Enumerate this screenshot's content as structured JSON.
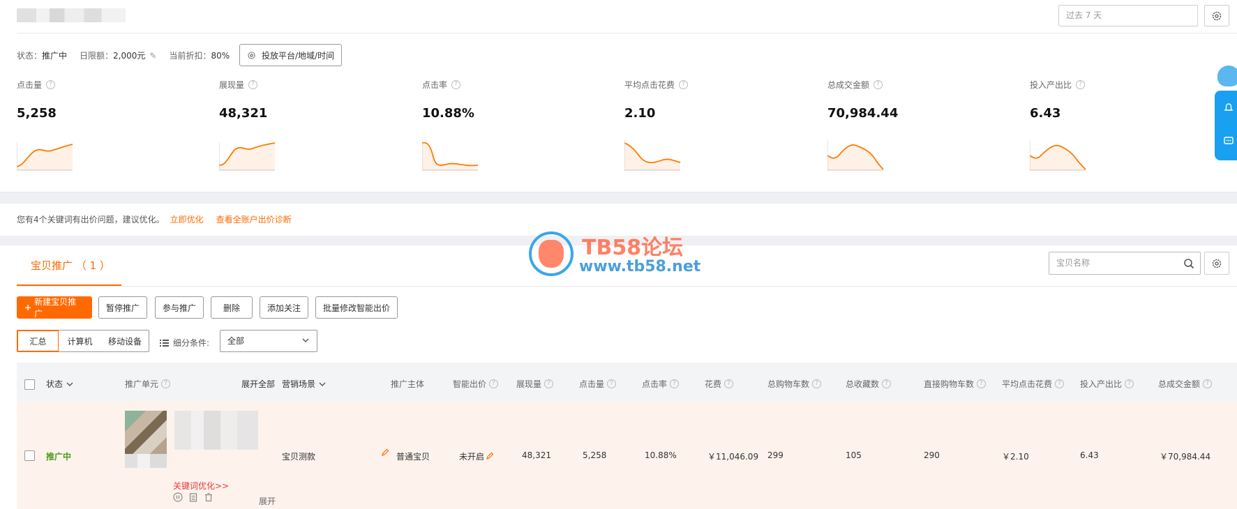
{
  "header": {
    "date_range_placeholder": "过去 7 天"
  },
  "status": {
    "state_label": "状态：",
    "state_value": "推广中",
    "budget_label": "日限额：",
    "budget_value": "2,000元",
    "discount_label": "当前折扣：",
    "discount_value": "80%",
    "platform_button": "投放平台/地域/时间"
  },
  "metrics": [
    {
      "label": "点击量",
      "value": "5,258"
    },
    {
      "label": "展现量",
      "value": "48,321"
    },
    {
      "label": "点击率",
      "value": "10.88%"
    },
    {
      "label": "平均点击花费",
      "value": "2.10"
    },
    {
      "label": "总成交金额",
      "value": "70,984.44"
    },
    {
      "label": "投入产出比",
      "value": "6.43"
    }
  ],
  "tip": {
    "text": "您有4个关键词有出价问题，建议优化。",
    "link1": "立即优化",
    "link2": "查看全账户出价诊断"
  },
  "main": {
    "tab_label": "宝贝推广 （ 1 ）",
    "search_placeholder": "宝贝名称",
    "buttons": {
      "new": "新建宝贝推广",
      "pause": "暂停推广",
      "join": "参与推广",
      "delete": "删除",
      "follow": "添加关注",
      "batch": "批量修改智能出价"
    },
    "segments": [
      "汇总",
      "计算机",
      "移动设备"
    ],
    "filter_label": "细分条件:",
    "filter_value": "全部"
  },
  "table": {
    "headers": {
      "status": "状态",
      "unit": "推广单元",
      "expand_all": "展开全部",
      "scene": "营销场景",
      "subject": "推广主体",
      "smart_bid": "智能出价",
      "impressions": "展现量",
      "clicks": "点击量",
      "ctr": "点击率",
      "cost": "花费",
      "cart_total": "总购物车数",
      "fav_total": "总收藏数",
      "cart_direct": "直接购物车数",
      "avg_cpc": "平均点击花费",
      "roi": "投入产出比",
      "gmv": "总成交金额"
    },
    "row": {
      "status": "推广中",
      "scene": "宝贝测款",
      "subject": "普通宝贝",
      "smart_bid": "未开启",
      "impressions": "48,321",
      "clicks": "5,258",
      "ctr": "10.88%",
      "cost": "￥11,046.09",
      "cart_total": "299",
      "fav_total": "105",
      "cart_direct": "290",
      "avg_cpc": "￥2.10",
      "roi": "6.43",
      "gmv": "￥70,984.44",
      "keyword_link": "关键词优化>>",
      "expand": "展开"
    }
  },
  "watermark": {
    "title": "TB58论坛",
    "url": "www.tb58.net"
  },
  "colors": {
    "accent": "#ff6a00",
    "status_green": "#4a9d1a",
    "row_bg": "#fdf3ec"
  }
}
